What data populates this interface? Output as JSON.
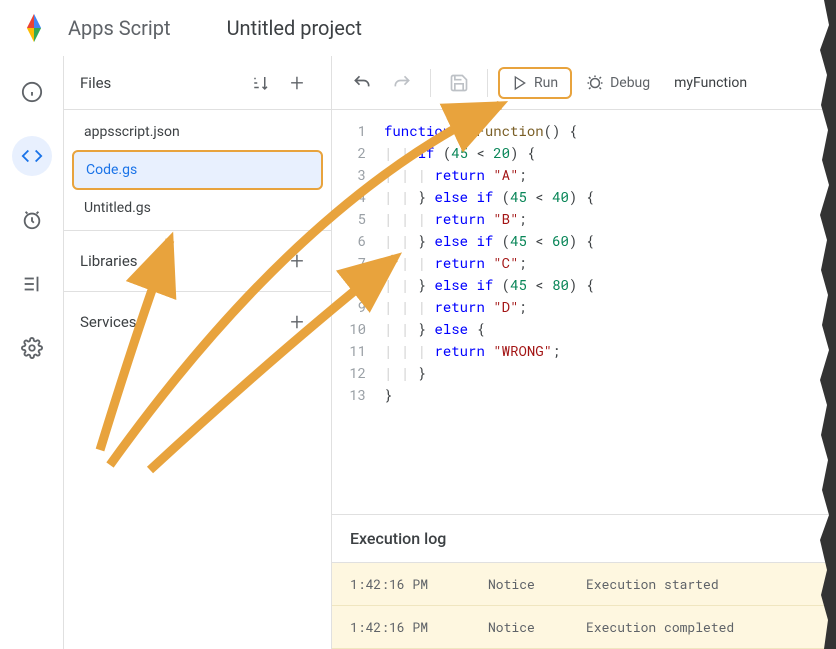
{
  "header": {
    "app_name": "Apps Script",
    "project_title": "Untitled project"
  },
  "sidebar": {
    "files_label": "Files",
    "files": [
      {
        "name": "appsscript.json",
        "selected": false
      },
      {
        "name": "Code.gs",
        "selected": true
      },
      {
        "name": "Untitled.gs",
        "selected": false
      }
    ],
    "libraries_label": "Libraries",
    "services_label": "Services"
  },
  "toolbar": {
    "run_label": "Run",
    "debug_label": "Debug",
    "function_name": "myFunction"
  },
  "code": {
    "lines": [
      "function myFunction() {",
      "    if (45 < 20) {",
      "      return \"A\";",
      "    } else if (45 < 40) {",
      "      return \"B\";",
      "    } else if (45 < 60) {",
      "      return \"C\";",
      "    } else if (45 < 80) {",
      "      return \"D\";",
      "    } else {",
      "      return \"WRONG\";",
      "    }",
      "}"
    ]
  },
  "log": {
    "header": "Execution log",
    "rows": [
      {
        "time": "1:42:16 PM",
        "level": "Notice",
        "msg": "Execution started"
      },
      {
        "time": "1:42:16 PM",
        "level": "Notice",
        "msg": "Execution completed"
      }
    ]
  }
}
